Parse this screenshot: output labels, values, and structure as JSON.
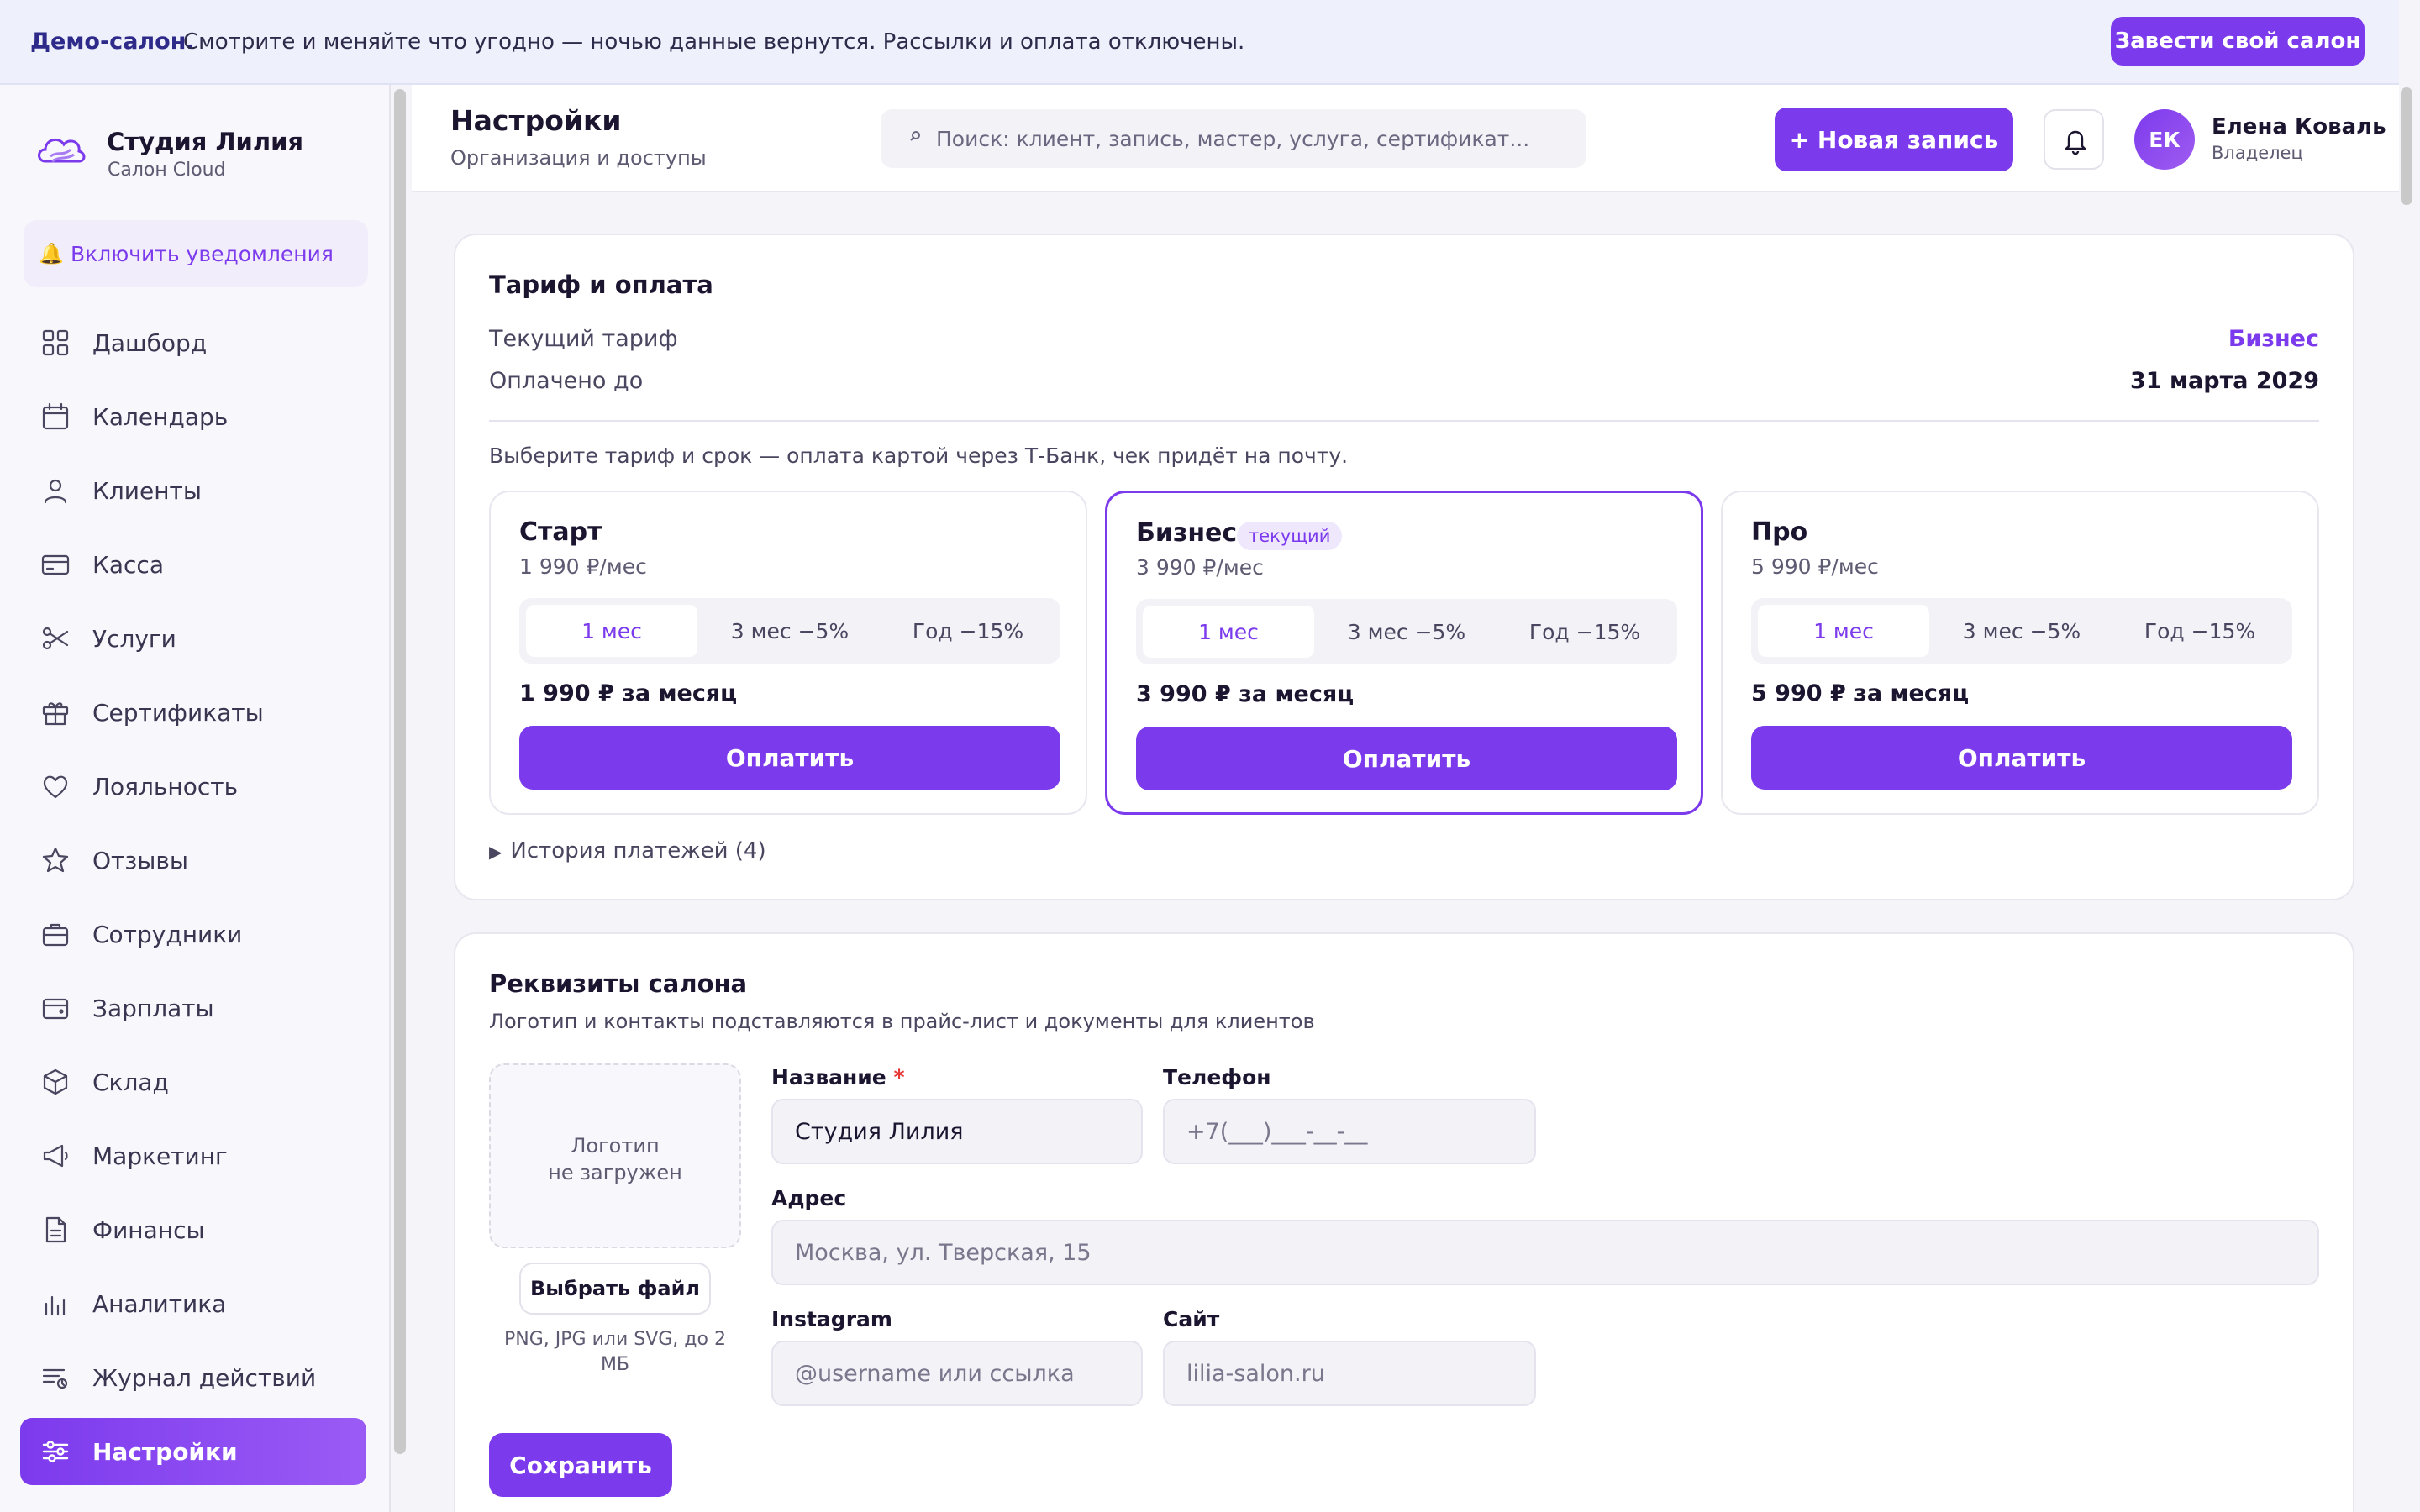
{
  "banner": {
    "title": "Демо-салон.",
    "text": "Смотрите и меняйте что угодно — ночью данные вернутся. Рассылки и оплата отключены.",
    "button": "Завести свой салон"
  },
  "brand": {
    "name": "Студия Лилия",
    "sub": "Салон Cloud"
  },
  "sidebar": {
    "notifications": "Включить уведомления",
    "items": [
      {
        "label": "Дашборд",
        "icon": "grid-icon"
      },
      {
        "label": "Календарь",
        "icon": "calendar-icon"
      },
      {
        "label": "Клиенты",
        "icon": "user-icon"
      },
      {
        "label": "Касса",
        "icon": "card-icon"
      },
      {
        "label": "Услуги",
        "icon": "scissors-icon"
      },
      {
        "label": "Сертификаты",
        "icon": "gift-icon"
      },
      {
        "label": "Лояльность",
        "icon": "heart-icon"
      },
      {
        "label": "Отзывы",
        "icon": "star-icon"
      },
      {
        "label": "Сотрудники",
        "icon": "briefcase-icon"
      },
      {
        "label": "Зарплаты",
        "icon": "wallet-icon"
      },
      {
        "label": "Склад",
        "icon": "box-icon"
      },
      {
        "label": "Маркетинг",
        "icon": "megaphone-icon"
      },
      {
        "label": "Финансы",
        "icon": "document-icon"
      },
      {
        "label": "Аналитика",
        "icon": "bar-chart-icon"
      },
      {
        "label": "Журнал действий",
        "icon": "log-icon"
      },
      {
        "label": "Настройки",
        "icon": "sliders-icon",
        "active": true
      }
    ]
  },
  "header": {
    "title": "Настройки",
    "subtitle": "Организация и доступы",
    "search_placeholder": "Поиск: клиент, запись, мастер, услуга, сертификат...",
    "new_button": "+ Новая запись",
    "user_initials": "ЕК",
    "user_name": "Елена Коваль",
    "user_role": "Владелец"
  },
  "billing": {
    "title": "Тариф и оплата",
    "current_label": "Текущий тариф",
    "current_value": "Бизнес",
    "paid_label": "Оплачено до",
    "paid_value": "31 марта 2029",
    "hint": "Выберите тариф и срок — оплата картой через Т-Банк, чек придёт на почту.",
    "plans": [
      {
        "name": "Старт",
        "badge": "",
        "price": "1 990 ₽/мес",
        "options": [
          "1 мес",
          "3 мес −5%",
          "Год −15%"
        ],
        "selected": 0,
        "total": "1 990 ₽ за месяц",
        "pay": "Оплатить"
      },
      {
        "name": "Бизнес",
        "badge": "текущий",
        "price": "3 990 ₽/мес",
        "options": [
          "1 мес",
          "3 мес −5%",
          "Год −15%"
        ],
        "selected": 0,
        "total": "3 990 ₽ за месяц",
        "pay": "Оплатить"
      },
      {
        "name": "Про",
        "badge": "",
        "price": "5 990 ₽/мес",
        "options": [
          "1 мес",
          "3 мес −5%",
          "Год −15%"
        ],
        "selected": 0,
        "total": "5 990 ₽ за месяц",
        "pay": "Оплатить"
      }
    ],
    "history": "История платежей (4)"
  },
  "requisites": {
    "title": "Реквизиты салона",
    "subtitle": "Логотип и контакты подставляются в прайс-лист и документы для клиентов",
    "logo_line1": "Логотип",
    "logo_line2": "не загружен",
    "file_button": "Выбрать файл",
    "file_hint": "PNG, JPG или SVG, до 2 МБ",
    "name_label": "Название",
    "required_mark": "*",
    "name_value": "Студия Лилия",
    "phone_label": "Телефон",
    "phone_placeholder": "+7(___)___-__-__",
    "address_label": "Адрес",
    "address_placeholder": "Москва, ул. Тверская, 15",
    "instagram_label": "Instagram",
    "instagram_placeholder": "@username или ссылка",
    "site_label": "Сайт",
    "site_placeholder": "lilia-salon.ru",
    "save": "Сохранить"
  },
  "colors": {
    "accent": "#7c3aed",
    "accent_light": "#efe8fd",
    "background": "#f5f4f8"
  }
}
